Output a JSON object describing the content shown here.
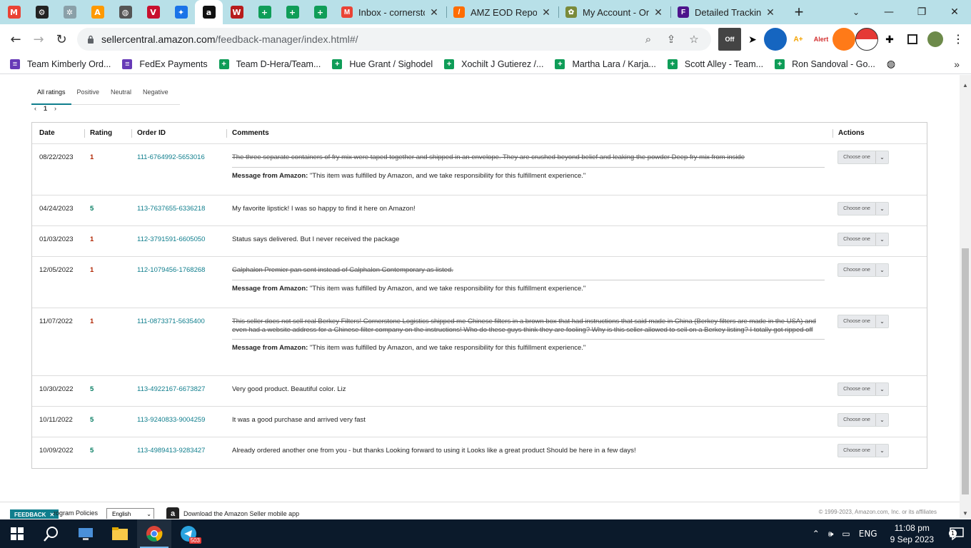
{
  "browser": {
    "pinned_tabs": [
      {
        "icon": "gmail-icon",
        "letter": "M",
        "color": "#ea4335"
      },
      {
        "icon": "openai-icon",
        "letter": "⚙",
        "color": "#222222"
      },
      {
        "icon": "app-icon",
        "letter": "✲",
        "color": "#8aa0a8"
      },
      {
        "icon": "app-icon",
        "letter": "A",
        "color": "#ff9900"
      },
      {
        "icon": "globe-icon",
        "letter": "◍",
        "color": "#555555"
      },
      {
        "icon": "vivid-icon",
        "letter": "V",
        "color": "#c8102e"
      },
      {
        "icon": "walmart-icon",
        "letter": "✦",
        "color": "#1a73e8"
      },
      {
        "icon": "amazon-icon",
        "letter": "a",
        "color": "#111111"
      },
      {
        "icon": "ww-icon",
        "letter": "W",
        "color": "#b71c1c"
      },
      {
        "icon": "sheets-icon",
        "letter": "+",
        "color": "#0f9d58"
      },
      {
        "icon": "sheets-icon",
        "letter": "+",
        "color": "#0f9d58"
      },
      {
        "icon": "sheets-icon",
        "letter": "+",
        "color": "#0f9d58"
      }
    ],
    "tabs": [
      {
        "title": "Inbox - cornerstc",
        "fav_letter": "M",
        "fav_color": "#ea4335"
      },
      {
        "title": "AMZ EOD Report",
        "fav_letter": "/",
        "fav_color": "#ff6d00"
      },
      {
        "title": "My Account - Or",
        "fav_letter": "✿",
        "fav_color": "#7a8a3a"
      },
      {
        "title": "Detailed Tracking",
        "fav_letter": "F",
        "fav_color": "#4d148c"
      }
    ],
    "new_tab": "+",
    "url_host": "sellercentral.amazon.com",
    "url_path": "/feedback-manager/index.html#/",
    "bookmarks": [
      {
        "label": "Team Kimberly Ord...",
        "color": "#673ab7",
        "letter": "≡"
      },
      {
        "label": "FedEx Payments",
        "color": "#673ab7",
        "letter": "≡"
      },
      {
        "label": "Team D-Hera/Team...",
        "color": "#0f9d58",
        "letter": "+"
      },
      {
        "label": "Hue Grant / Sighodel",
        "color": "#0f9d58",
        "letter": "+"
      },
      {
        "label": "Xochilt J Gutierez /...",
        "color": "#0f9d58",
        "letter": "+"
      },
      {
        "label": "Martha Lara / Karja...",
        "color": "#0f9d58",
        "letter": "+"
      },
      {
        "label": "Scott Alley - Team...",
        "color": "#0f9d58",
        "letter": "+"
      },
      {
        "label": "Ron Sandoval - Go...",
        "color": "#0f9d58",
        "letter": "+"
      }
    ]
  },
  "feedback": {
    "filters": [
      "All ratings",
      "Positive",
      "Neutral",
      "Negative"
    ],
    "page": "1",
    "headers": {
      "date": "Date",
      "rating": "Rating",
      "order": "Order ID",
      "comments": "Comments",
      "actions": "Actions"
    },
    "action_label": "Choose one",
    "message_prefix": "Message from Amazon:",
    "message_text": "\"This item was fulfilled by Amazon, and we take responsibility for this fulfillment experience.\"",
    "rows": [
      {
        "date": "08/22/2023",
        "rating": "1",
        "order": "111-6764992-5653016",
        "comment": "The three separate containers of fry mix were taped together and shipped in an envelope. They are crushed beyond belief and leaking the powder Deep fry mix from inside",
        "struck": true
      },
      {
        "date": "04/24/2023",
        "rating": "5",
        "order": "113-7637655-6336218",
        "comment": "My favorite lipstick! I was so happy to find it here on Amazon!",
        "struck": false
      },
      {
        "date": "01/03/2023",
        "rating": "1",
        "order": "112-3791591-6605050",
        "comment": "Status says delivered. But I never received the package",
        "struck": false
      },
      {
        "date": "12/05/2022",
        "rating": "1",
        "order": "112-1079456-1768268",
        "comment": "Calphalon Premier pan sent instead of Calphalon Contemporary as listed.",
        "struck": true
      },
      {
        "date": "11/07/2022",
        "rating": "1",
        "order": "111-0873371-5635400",
        "comment": "This seller does not sell real Berkey Filters! Cornerstone Logistics shipped me Chinese filters in a brown box that had instructions that said made in China (Berkey filters are made in the USA) and even had a website address for a Chinese filter company on the instructions! Who do these guys think they are fooling? Why is this seller allowed to sell on a Berkey listing? I totally got ripped off",
        "struck": true
      },
      {
        "date": "10/30/2022",
        "rating": "5",
        "order": "113-4922167-6673827",
        "comment": "Very good product. Beautiful color. Liz",
        "struck": false
      },
      {
        "date": "10/11/2022",
        "rating": "5",
        "order": "113-9240833-9004259",
        "comment": "It was a good purchase and arrived very fast",
        "struck": false
      },
      {
        "date": "10/09/2022",
        "rating": "5",
        "order": "113-4989413-9283427",
        "comment": "Already ordered another one from you - but thanks Looking forward to using it Looks like a great product Should be here in a few days!",
        "struck": false
      }
    ]
  },
  "footer": {
    "feedback_btn": "FEEDBACK",
    "program_policies": "rogram Policies",
    "language": "English",
    "download_app": "Download the Amazon Seller mobile app",
    "copyright": "© 1999-2023, Amazon.com, Inc. or its affiliates"
  },
  "taskbar": {
    "language": "ENG",
    "time": "11:08 pm",
    "date": "9 Sep 2023",
    "telegram_badge": "503",
    "notifications": "1"
  }
}
